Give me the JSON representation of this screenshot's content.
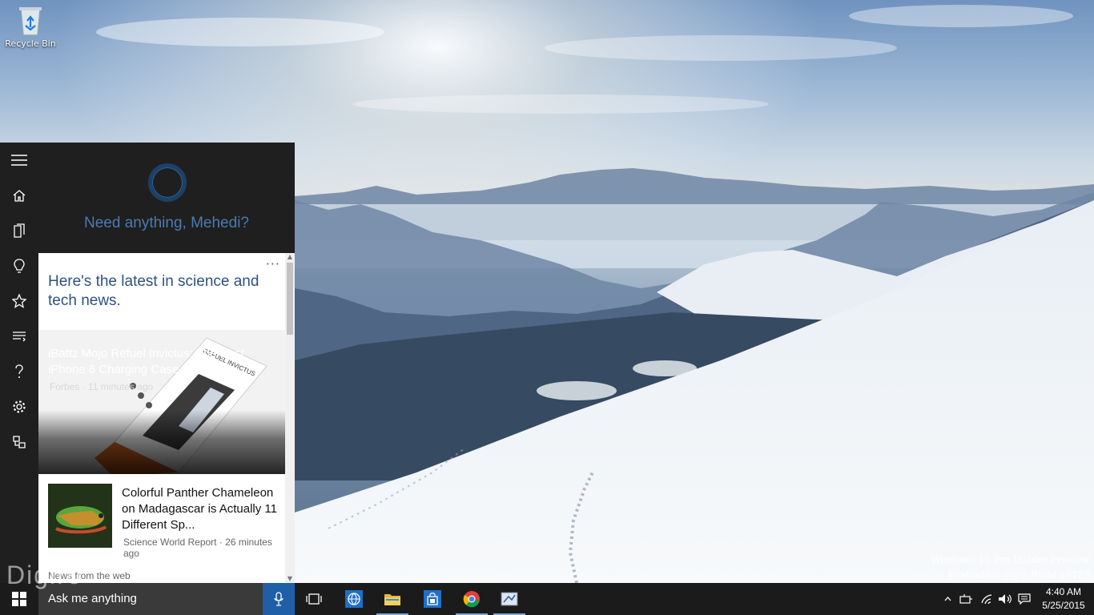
{
  "desktop": {
    "recycle_bin_label": "Recycle Bin",
    "watermark_line1": "Windows 10 Pro Insider Preview",
    "watermark_line2": "Evaluation copy. Build 10125",
    "brand_overlay": "Digiro"
  },
  "cortana": {
    "greeting": "Need anything, Mehedi?",
    "rail_icons": [
      "hamburger-icon",
      "home-icon",
      "notebook-icon",
      "lightbulb-icon",
      "star-icon",
      "reminders-icon",
      "help-icon",
      "settings-icon",
      "feedback-icon"
    ],
    "news_header": "Here's the latest in science and tech news.",
    "more_label": "···",
    "hero": {
      "headline": "iBattz Mojo Refuel Invictus: The Best iPhone 6 Charging Case Yet?",
      "meta": "Forbes · 11 minutes ago",
      "box_text": "REFUEL INVICTUS"
    },
    "item": {
      "title": "Colorful Panther Chameleon on Madagascar is Actually 11 Different Sp...",
      "source": "Science World Report · 26 minutes ago"
    },
    "from_web": "News from the web"
  },
  "taskbar": {
    "search_placeholder": "Ask me anything",
    "apps": [
      "task-view-icon",
      "edge-globe-icon",
      "file-explorer-icon",
      "store-icon",
      "chrome-icon",
      "app-icon"
    ],
    "clock_time": "4:40 AM",
    "clock_date": "5/25/2015",
    "accent": "#1e5fa8"
  }
}
